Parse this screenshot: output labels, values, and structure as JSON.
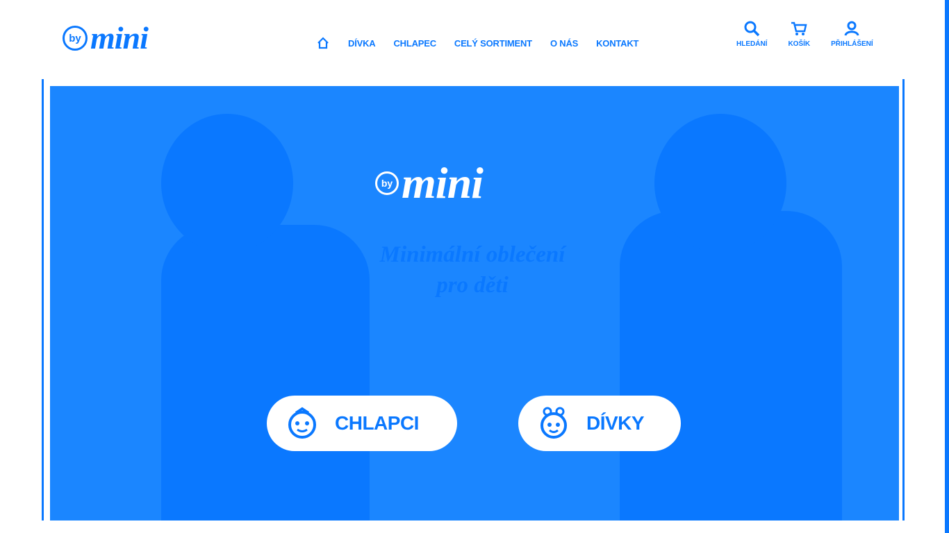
{
  "brand": {
    "by": "by",
    "name": "mini"
  },
  "nav": {
    "home_icon": "home-icon",
    "items": [
      {
        "label": "DÍVKA"
      },
      {
        "label": "CHLAPEC"
      },
      {
        "label": "CELÝ SORTIMENT"
      },
      {
        "label": "O NÁS"
      },
      {
        "label": "KONTAKT"
      }
    ]
  },
  "utilities": [
    {
      "icon": "search-icon",
      "label": "HLEDÁNÍ"
    },
    {
      "icon": "cart-icon",
      "label": "KOŠÍK"
    },
    {
      "icon": "user-icon",
      "label": "PŘIHLÁŠENÍ"
    }
  ],
  "hero": {
    "logo_by": "by",
    "logo_name": "mini",
    "tagline_line1": "Minimální oblečení",
    "tagline_line2": "pro děti",
    "buttons": [
      {
        "icon": "boy-icon",
        "label": "CHLAPCI"
      },
      {
        "icon": "girl-icon",
        "label": "DÍVKY"
      }
    ]
  },
  "colors": {
    "accent": "#0a78ff",
    "background": "#ffffff",
    "hero": "#1b86ff"
  }
}
